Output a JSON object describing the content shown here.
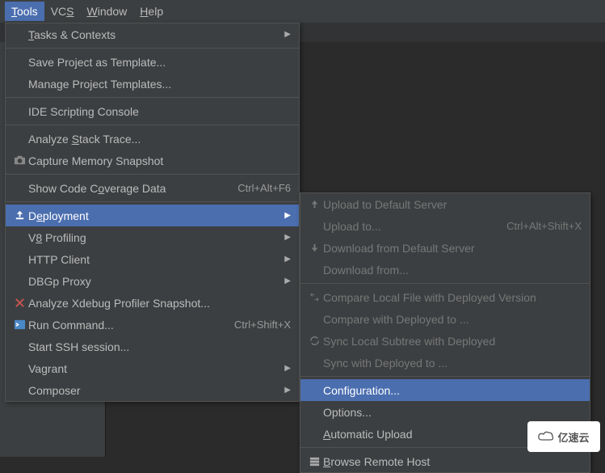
{
  "menubar": {
    "tools": "Tools",
    "vcs": "VCS",
    "window": "Window",
    "help": "Help"
  },
  "tools_menu": {
    "tasks": "Tasks & Contexts",
    "save_tpl": "Save Project as Template...",
    "manage_tpl": "Manage Project Templates...",
    "ide_script": "IDE Scripting Console",
    "stack_trace": "Analyze Stack Trace...",
    "mem_snap": "Capture Memory Snapshot",
    "coverage": "Show Code Coverage Data",
    "coverage_sc": "Ctrl+Alt+F6",
    "deployment": "Deployment",
    "v8": "V8 Profiling",
    "http": "HTTP Client",
    "dbgp": "DBGp Proxy",
    "xdebug": "Analyze Xdebug Profiler Snapshot...",
    "run_cmd": "Run Command...",
    "run_cmd_sc": "Ctrl+Shift+X",
    "ssh": "Start SSH session...",
    "vagrant": "Vagrant",
    "composer": "Composer"
  },
  "deploy_menu": {
    "upload_default": "Upload to Default Server",
    "upload_to": "Upload to...",
    "upload_to_sc": "Ctrl+Alt+Shift+X",
    "download_default": "Download from Default Server",
    "download_from": "Download from...",
    "compare_file": "Compare Local File with Deployed Version",
    "compare_with": "Compare with Deployed to ...",
    "sync_local": "Sync Local Subtree with Deployed",
    "sync_with": "Sync with Deployed to ...",
    "configuration": "Configuration...",
    "options": "Options...",
    "auto_upload": "Automatic Upload",
    "browse_host": "Browse Remote Host"
  },
  "watermark": "亿速云"
}
